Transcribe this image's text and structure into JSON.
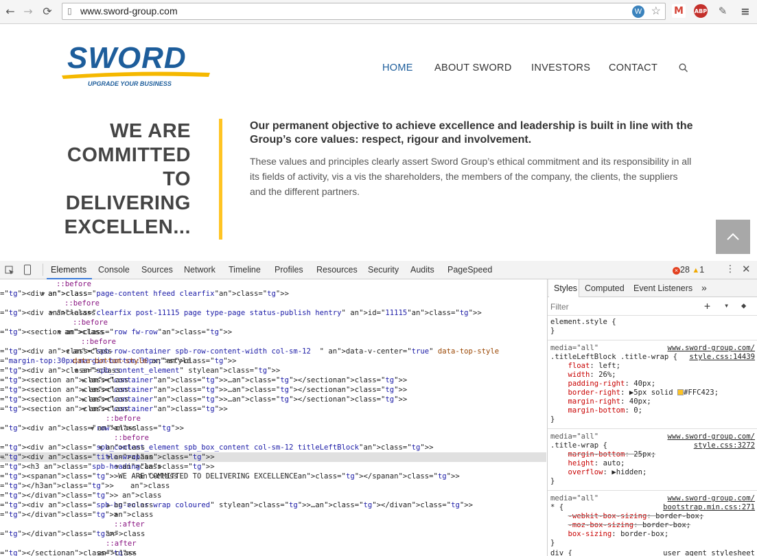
{
  "browser": {
    "url": "www.sword-group.com"
  },
  "site": {
    "logo": {
      "word": "SWORD",
      "tagline": "UPGRADE YOUR BUSINESS"
    },
    "nav": [
      "HOME",
      "ABOUT SWORD",
      "INVESTORS",
      "CONTACT"
    ],
    "heading": [
      "WE ARE",
      "COMMITTED",
      "TO",
      "DELIVERING",
      "EXCELLEN..."
    ],
    "lead": "Our permanent objective to achieve excellence and leadership is built in line with the Group’s core values: respect, rigour and involvement.",
    "body": "These values and principles clearly assert Sword Group’s ethical commitment and its responsibility in all its fields of activity, vis a vis the shareholders, the members of the company, the clients, the suppliers and the different partners.",
    "accent": "#FFC423"
  },
  "devtools": {
    "tabs": [
      "Elements",
      "Console",
      "Sources",
      "Network",
      "Timeline",
      "Profiles",
      "Resources",
      "Security",
      "Audits",
      "PageSpeed"
    ],
    "errors": "28",
    "warnings": "1",
    "dom": [
      {
        "i": "",
        "t": "::before"
      },
      {
        "i": "▼",
        "t": "<div class=\"page-content hfeed clearfix\">"
      },
      {
        "i": "",
        "t": "::before"
      },
      {
        "i": "▼",
        "t": "<div class=\"clearfix post-11115 page type-page status-publish hentry\" id=\"11115\">"
      },
      {
        "i": "",
        "t": "::before"
      },
      {
        "i": "▼",
        "t": "<section class=\"row fw-row\">"
      },
      {
        "i": "",
        "t": "::before"
      },
      {
        "i": "▼",
        "t": "<div class=\"spb-row-container spb-row-content-width col-sm-12  \" data-v-center=\"true\" data-top-style"
      },
      {
        "i": "",
        "t": "data-bottom-style style=\"margin-top:30px;margin-bottom:30px;\">"
      },
      {
        "i": "▼",
        "t": "<div class=\"spb_content_element\" style>"
      },
      {
        "i": "▶",
        "t": "<section class=\"container\">…</section>"
      },
      {
        "i": "▶",
        "t": "<section class=\"container\">…</section>"
      },
      {
        "i": "▶",
        "t": "<section class=\"container\">…</section>"
      },
      {
        "i": "▼",
        "t": "<section class=\"container\">"
      },
      {
        "i": "",
        "t": "::before"
      },
      {
        "i": "▼",
        "t": "<div class=\"row\">"
      },
      {
        "i": "",
        "t": "::before"
      },
      {
        "i": "▼",
        "t": "<div class=\"spb_content_element spb_box_content col-sm-12 titleLeftBlock\">"
      },
      {
        "i": "▼",
        "t": "<div class=\"title-wrap\">"
      },
      {
        "i": "▼",
        "t": "<h3 class=\"spb-heading\">"
      },
      {
        "i": "",
        "t": "<span>WE ARE COMMITTED TO DELIVERING EXCELLENCE</span>"
      },
      {
        "i": "",
        "t": "</h3>"
      },
      {
        "i": "",
        "t": "</div>"
      },
      {
        "i": "▶",
        "t": "<div class=\"spb-bg-color-wrap coloured\" style>…</div>"
      },
      {
        "i": "",
        "t": "</div>"
      },
      {
        "i": "",
        "t": "::after"
      },
      {
        "i": "",
        "t": "</div>"
      },
      {
        "i": "",
        "t": "::after"
      },
      {
        "i": "",
        "t": "</section>"
      }
    ],
    "styles_tabs": [
      "Styles",
      "Computed",
      "Event Listeners"
    ],
    "filter_placeholder": "Filter",
    "rules": [
      {
        "k": "sel",
        "t": "element.style {"
      },
      {
        "k": "close",
        "t": "}"
      },
      {
        "k": "media",
        "t": "media=\"all\"",
        "src": "www.sword-group.com/"
      },
      {
        "k": "sel",
        "t": ".titleLeftBlock .title-wrap {",
        "src": "style.css:14439"
      },
      {
        "k": "prop",
        "p": "float",
        "v": "left;"
      },
      {
        "k": "prop",
        "p": "width",
        "v": "26%;"
      },
      {
        "k": "prop",
        "p": "padding-right",
        "v": "40px;"
      },
      {
        "k": "prop",
        "p": "border-right",
        "v": "▶5px solid ■#FFC423;"
      },
      {
        "k": "prop",
        "p": "margin-right",
        "v": "40px;"
      },
      {
        "k": "prop",
        "p": "margin-bottom",
        "v": "0;"
      },
      {
        "k": "close",
        "t": "}"
      },
      {
        "k": "media",
        "t": "media=\"all\"",
        "src": "www.sword-group.com/"
      },
      {
        "k": "sel",
        "t": ".title-wrap {",
        "src": "style.css:3272"
      },
      {
        "k": "strike",
        "p": "margin-bottom",
        "v": "25px;"
      },
      {
        "k": "prop",
        "p": "height",
        "v": "auto;"
      },
      {
        "k": "prop",
        "p": "overflow",
        "v": "▶hidden;"
      },
      {
        "k": "close",
        "t": "}"
      },
      {
        "k": "media",
        "t": "media=\"all\"",
        "src": "www.sword-group.com/"
      },
      {
        "k": "sel",
        "t": "* {",
        "src": "bootstrap.min.css:271"
      },
      {
        "k": "strike",
        "p": "-webkit-box-sizing",
        "v": "border-box;"
      },
      {
        "k": "strike",
        "p": "-moz-box-sizing",
        "v": "border-box;"
      },
      {
        "k": "prop",
        "p": "box-sizing",
        "v": "border-box;"
      },
      {
        "k": "close",
        "t": "}"
      },
      {
        "k": "sel",
        "t": "div {",
        "src": "user agent stylesheet"
      }
    ]
  }
}
